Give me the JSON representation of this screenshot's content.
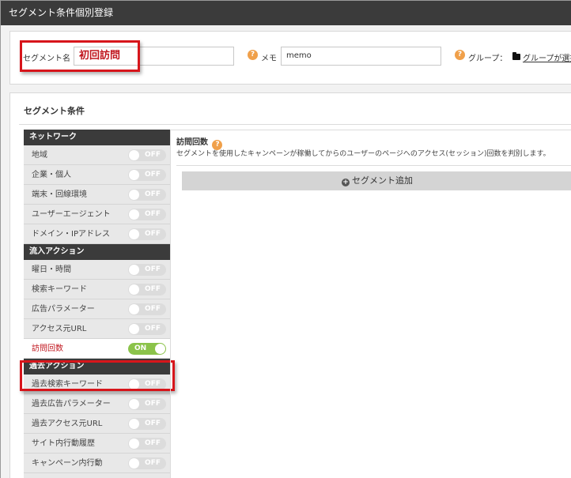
{
  "window": {
    "title": "セグメント条件個別登録"
  },
  "form": {
    "segment_name_label": "セグメント名",
    "segment_name_value": "初回訪問",
    "memo_label": "メモ",
    "memo_value": "memo",
    "group_label": "グループ：",
    "group_link": "グループが選択"
  },
  "conditions": {
    "title": "セグメント条件",
    "categories": [
      {
        "label": "ネットワーク",
        "items": [
          {
            "label": "地域",
            "state": "OFF"
          },
          {
            "label": "企業・個人",
            "state": "OFF"
          },
          {
            "label": "端末・回線環境",
            "state": "OFF"
          },
          {
            "label": "ユーザーエージェント",
            "state": "OFF"
          },
          {
            "label": "ドメイン・IPアドレス",
            "state": "OFF"
          }
        ]
      },
      {
        "label": "流入アクション",
        "items": [
          {
            "label": "曜日・時間",
            "state": "OFF"
          },
          {
            "label": "検索キーワード",
            "state": "OFF"
          },
          {
            "label": "広告パラメーター",
            "state": "OFF"
          },
          {
            "label": "アクセス元URL",
            "state": "OFF"
          },
          {
            "label": "訪問回数",
            "state": "ON"
          }
        ]
      },
      {
        "label": "過去アクション",
        "items": [
          {
            "label": "過去検索キーワード",
            "state": "OFF"
          },
          {
            "label": "過去広告パラメーター",
            "state": "OFF"
          },
          {
            "label": "過去アクセス元URL",
            "state": "OFF"
          },
          {
            "label": "サイト内行動履歴",
            "state": "OFF"
          },
          {
            "label": "キャンペーン内行動",
            "state": "OFF"
          }
        ]
      }
    ]
  },
  "detail": {
    "title": "訪問回数",
    "description": "セグメントを使用したキャンペーンが稼働してからのユーザーのページへのアクセス(セッション)回数を判別します。",
    "add_button": "セグメント追加"
  },
  "colors": {
    "header_bg": "#3b3b3b",
    "highlight_red": "#d7151b",
    "toggle_on": "#8bc34a",
    "toggle_off": "#dcdcdc",
    "help_icon": "#f0a04a"
  }
}
